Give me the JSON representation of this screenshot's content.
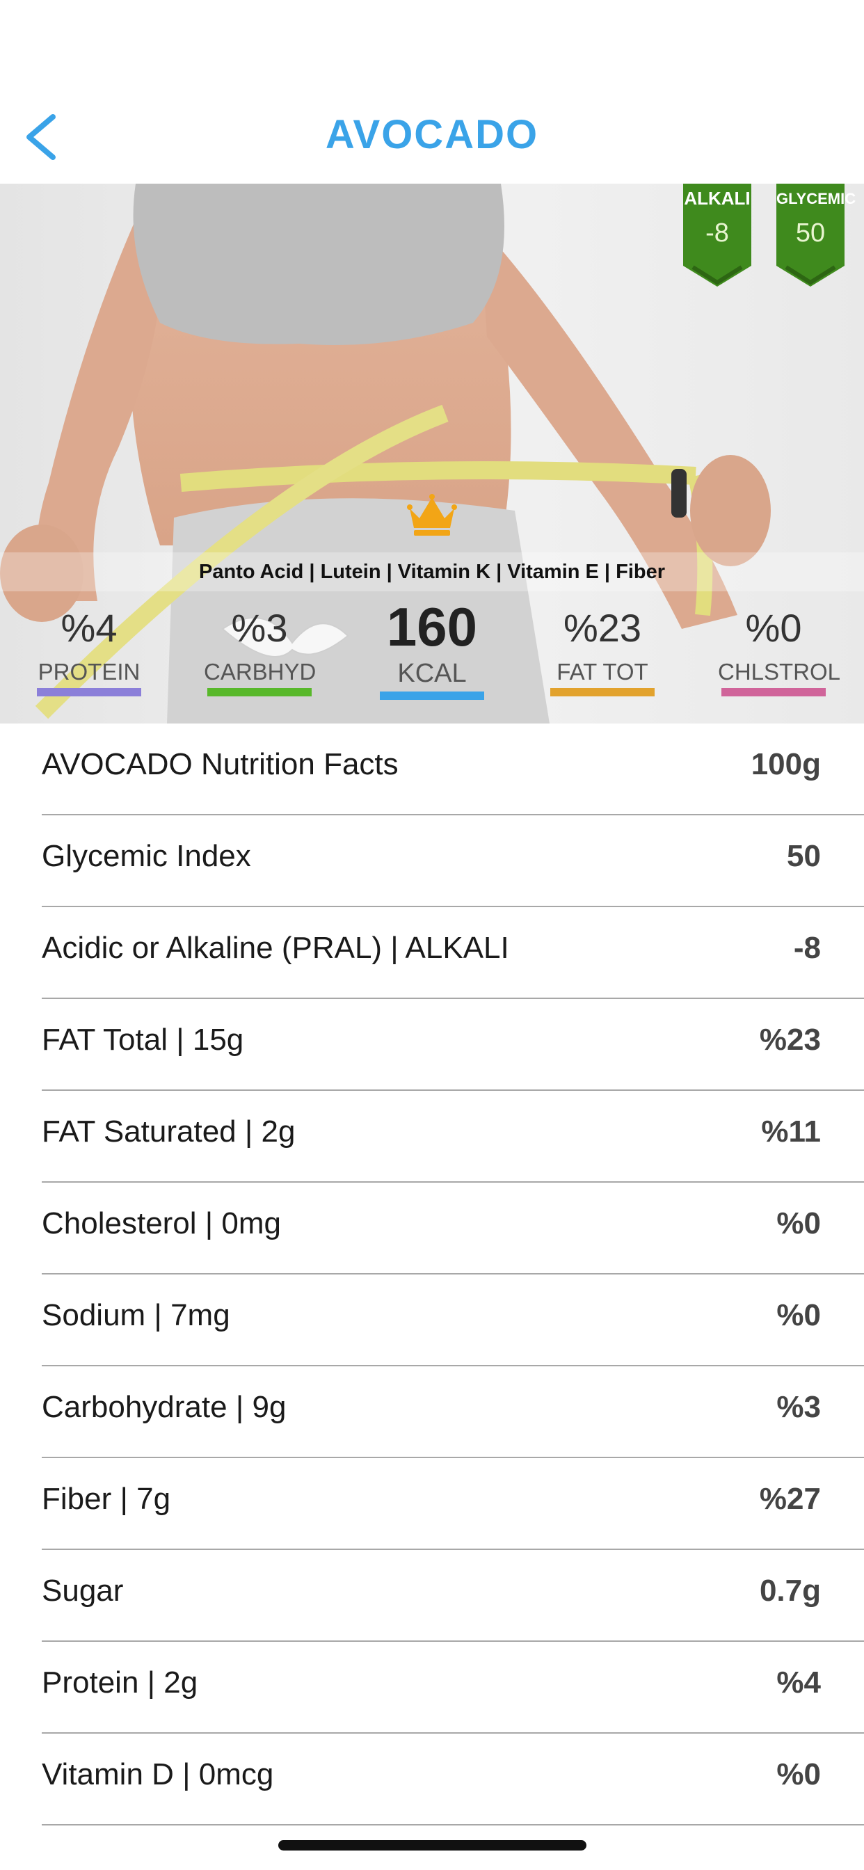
{
  "header": {
    "title": "AVOCADO",
    "back_icon": "chevron-left-icon",
    "accent_color": "#3aa3e8"
  },
  "badges": [
    {
      "label": "ALKALI",
      "value": "-8",
      "color": "#3f8a1d"
    },
    {
      "label": "GLYCEMIC",
      "value": "50",
      "color": "#3f8a1d"
    }
  ],
  "hero": {
    "crown_icon": "crown-icon",
    "minerals_text": "Panto Acid | Lutein | Vitamin K | Vitamin E | Fiber"
  },
  "stats": [
    {
      "value": "%4",
      "label": "PROTEIN",
      "color": "#8b7fd9"
    },
    {
      "value": "%3",
      "label": "CARBHYD",
      "color": "#58b82a"
    },
    {
      "value": "160",
      "label": "KCAL",
      "color": "#3aa3e8"
    },
    {
      "value": "%23",
      "label": "FAT TOT",
      "color": "#e2a22d"
    },
    {
      "value": "%0",
      "label": "CHLSTROL",
      "color": "#d0649a"
    }
  ],
  "nutrition": [
    {
      "label": "AVOCADO Nutrition Facts",
      "value": "100g"
    },
    {
      "label": "Glycemic Index",
      "value": "50"
    },
    {
      "label": "Acidic or Alkaline (PRAL) | ALKALI",
      "value": "-8"
    },
    {
      "label": "FAT Total | 15g",
      "value": "%23"
    },
    {
      "label": "FAT Saturated | 2g",
      "value": "%11"
    },
    {
      "label": "Cholesterol | 0mg",
      "value": "%0"
    },
    {
      "label": "Sodium | 7mg",
      "value": "%0"
    },
    {
      "label": "Carbohydrate | 9g",
      "value": "%3"
    },
    {
      "label": "Fiber | 7g",
      "value": "%27"
    },
    {
      "label": "Sugar",
      "value": "0.7g"
    },
    {
      "label": "Protein | 2g",
      "value": "%4"
    },
    {
      "label": "Vitamin D | 0mcg",
      "value": "%0"
    }
  ]
}
